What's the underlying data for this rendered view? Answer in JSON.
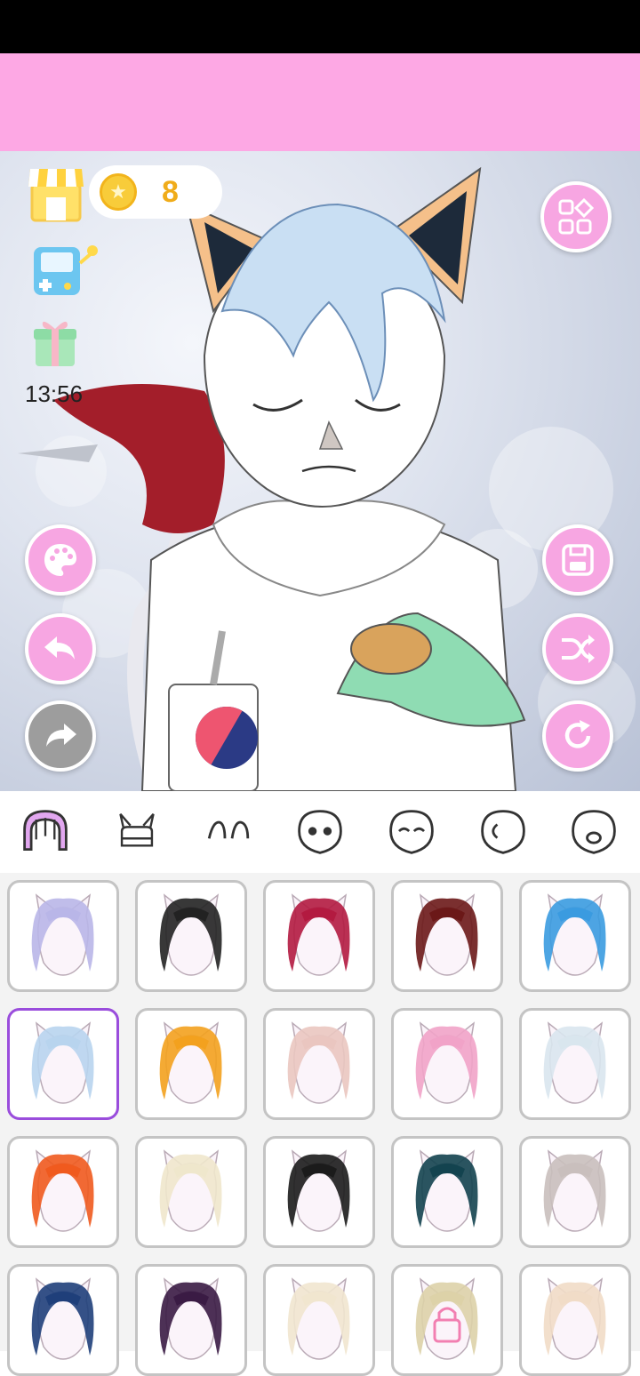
{
  "status_bar": {},
  "coins": {
    "count": "8"
  },
  "clock": {
    "time": "13:56"
  },
  "icons": {
    "shop": "shop-icon",
    "games": "game-console-icon",
    "gift": "gift-icon",
    "palette": "palette-icon",
    "undo": "undo-icon",
    "redo": "redo-icon",
    "categories": "categories-icon",
    "save": "save-icon",
    "shuffle": "shuffle-icon",
    "reset": "reset-icon",
    "lock": "lock-icon"
  },
  "tabs": [
    "hair",
    "horns",
    "eyebrows",
    "face-shape",
    "eyes",
    "ears",
    "mouth"
  ],
  "hair_items": [
    {
      "color": "#b9b6e8",
      "selected": false
    },
    {
      "color": "#222222",
      "selected": false
    },
    {
      "color": "#b31a40",
      "selected": false
    },
    {
      "color": "#6b1818",
      "selected": false
    },
    {
      "color": "#3a9be0",
      "selected": false
    },
    {
      "color": "#b8d4ee",
      "selected": true
    },
    {
      "color": "#f3a11e",
      "selected": false
    },
    {
      "color": "#eac6c0",
      "selected": false
    },
    {
      "color": "#f1a3c8",
      "selected": false
    },
    {
      "color": "#d9e6ee",
      "selected": false
    },
    {
      "color": "#f05a1e",
      "selected": false
    },
    {
      "color": "#efe7cc",
      "selected": false
    },
    {
      "color": "#1b1b1b",
      "selected": false
    },
    {
      "color": "#13434f",
      "selected": false
    },
    {
      "color": "#c9bfbd",
      "selected": false
    },
    {
      "color": "#1f3f7a",
      "selected": false
    },
    {
      "color": "#3a1b44",
      "selected": false
    },
    {
      "color": "#f1e6cf",
      "selected": false
    },
    {
      "color": "#ddd2a8",
      "selected": false,
      "locked": true
    },
    {
      "color": "#f1dcc7",
      "selected": false
    }
  ],
  "colors": {
    "accent_pink": "#F7A6E2",
    "banner_pink": "#FDA8E4",
    "selected_border": "#9A4DDC",
    "coin": "#F0AC1A"
  }
}
